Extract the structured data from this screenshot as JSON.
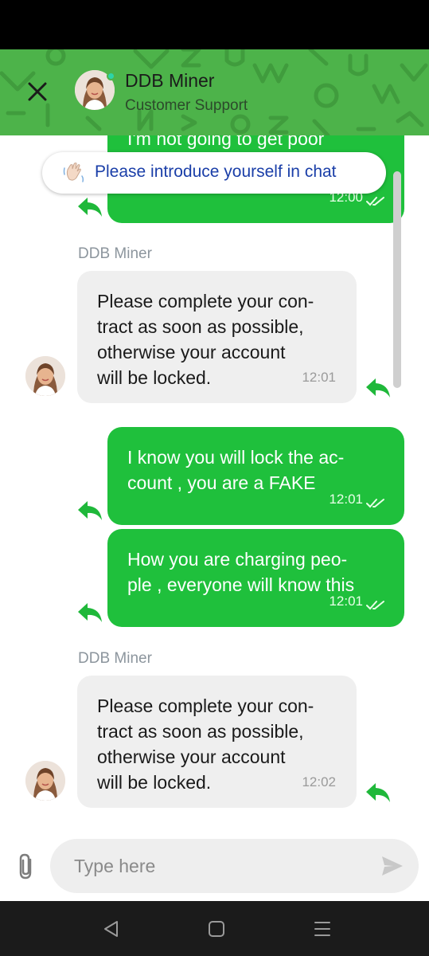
{
  "header": {
    "title": "DDB Miner",
    "subtitle": "Customer Support"
  },
  "notice": {
    "label": "Please introduce yourself in chat",
    "icon": "waving-hand-icon"
  },
  "messages": [
    {
      "direction": "out",
      "text": "I'm not going to get poor\n, you will loose all",
      "time": "12:00"
    },
    {
      "direction": "in",
      "sender": "DDB Miner",
      "text": "Please complete your con-\ntract as soon as possible,\notherwise your account\nwill be locked.",
      "time": "12:01"
    },
    {
      "direction": "out",
      "text": "I know you will lock the ac-\ncount , you are a FAKE",
      "time": "12:01"
    },
    {
      "direction": "out",
      "text": "How you are charging peo-\nple , everyone will know this",
      "time": "12:01"
    },
    {
      "direction": "in",
      "sender": "DDB Miner",
      "text": "Please complete your con-\ntract as soon as possible,\notherwise your account\nwill be locked.",
      "time": "12:02"
    }
  ],
  "composer": {
    "placeholder": "Type here"
  },
  "colors": {
    "header_green": "#4db34a",
    "outgoing_bubble": "#1fc03c",
    "incoming_bubble": "#efefef",
    "notice_text": "#1a3ea8"
  }
}
